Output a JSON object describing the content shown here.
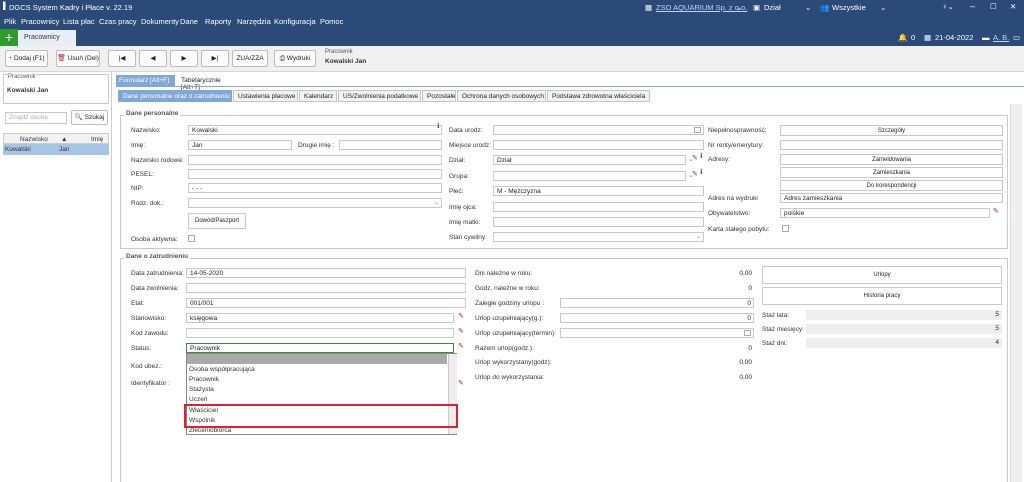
{
  "app": {
    "title": "DGCS System Kadry i Płace v. 22.19",
    "company": "ZSO AQUARIUM Sp. z o.o.",
    "dept": "Dział",
    "scope": "Wszystkie"
  },
  "menu": [
    "Plik",
    "Pracownicy",
    "Lista płac",
    "Czas pracy",
    "Dokumenty",
    "Dane",
    "Raporty",
    "Narzędzia",
    "Konfiguracja",
    "Pomoc"
  ],
  "statusbar": {
    "count": "0",
    "date": "21-04-2022",
    "user": "A. B."
  },
  "apptab": "Pracownicy",
  "toolbar": {
    "add": "Dodaj (F1)",
    "delete": "Usuń (Del)",
    "zua": "ZUA/ZZA",
    "print": "Wydruki",
    "emp_label": "Pracownik",
    "emp_name": "Kowalski Jan"
  },
  "sidebar": {
    "label": "Pracownik",
    "name": "Kowalski Jan",
    "search_placeholder": "Znajdź osobę",
    "search_btn": "Szukaj",
    "col1": "Nazwisko",
    "col2": "Imię",
    "row": {
      "surname": "Kowalski",
      "name": "Jan"
    }
  },
  "viewtabs": [
    "Formularz [Alt+F]",
    "Tabelarycznie [Alt+T]"
  ],
  "subtabs": [
    "Dane personalne oraz o zatrudnieniu",
    "Ustawienia płacowe",
    "Kalendarz",
    "US/Zwolnienia podatkowe",
    "Pozostałe",
    "Ochrona danych osobowych",
    "Podstawa zdrowotna właściciela"
  ],
  "personal": {
    "title": "Dane personalne",
    "surname_l": "Nazwisko:",
    "surname": "Kowalski",
    "name_l": "Imię:",
    "name": "Jan",
    "second_l": "Drugie imię :",
    "family_l": "Nazwisko rodowe:",
    "pesel_l": "PESEL:",
    "nip_l": "NIP:",
    "nip": "- - -",
    "doc_l": "Rodz. dok.:",
    "doc_btn": "Dowód/Paszport",
    "active_l": "Osoba aktywna:",
    "birth_l": "Data urodz:",
    "birthplace_l": "Miejsce urodz:",
    "dept_l": "Dział:",
    "dept": "Dział",
    "group_l": "Grupa:",
    "sex_l": "Płeć:",
    "sex": "M - Mężczyzna",
    "father_l": "Imię ojca:",
    "mother_l": "Imię matki:",
    "civil_l": "Stan cywilny:",
    "disab_l": "Niepełnosprawność:",
    "disab_btn": "Szczegóły",
    "pension_l": "Nr renty/emerytury:",
    "addr_l": "Adresy:",
    "addr1": "Zameldowania",
    "addr2": "Zamieszkania",
    "addr3": "Do korespondencji",
    "addrprint_l": "Adres na wydruki",
    "addrprint": "Adres zamieszkania",
    "citizen_l": "Obywatelstwo:",
    "citizen": "polskie",
    "card_l": "Karta stałego pobytu:"
  },
  "employment": {
    "title": "Dane o zatrudnieniu",
    "hire_l": "Data zatrudnienia:",
    "hire": "14-05-2020",
    "fire_l": "Data zwolnienia:",
    "etat_l": "Etat:",
    "etat": "001/001",
    "position_l": "Stanowisko:",
    "position": "księgowa",
    "code_l": "Kod zawodu:",
    "status_l": "Status:",
    "status": "Pracownik",
    "ins_l": "Kod ubez.:",
    "id_l": "Identyfikator :",
    "leave_year_l": "Dni należne w roku:",
    "leave_year": "0,00",
    "hours_year_l": "Godz. należne w roku:",
    "hours_year": "0",
    "overdue_l": "Zaległe godziny urlopu :",
    "overdue": "0",
    "supp_l": "Urlop uzupełniający(g.):",
    "supp": "0",
    "suppterm_l": "Urlop uzupełniający(termin):",
    "total_l": "Razem urlop(godz.):",
    "total": "0",
    "used_l": "Urlop wykorzystany(godz):",
    "used": "0,00",
    "remaining_l": "Urlop do wykorzystania:",
    "remaining": "0,00",
    "leaves_btn": "Urlopy",
    "history_btn": "Historia pracy",
    "sen_y_l": "Staż lata:",
    "sen_y": "5",
    "sen_m_l": "Staż miesięcy:",
    "sen_m": "5",
    "sen_d_l": "Staż dni:",
    "sen_d": "4"
  },
  "status_options": [
    "",
    "Osoba współpracująca",
    "Pracownik",
    "Stażysta",
    "Uczeń",
    "Właściciel",
    "Wspólnik",
    "Zleceniobiorca"
  ]
}
